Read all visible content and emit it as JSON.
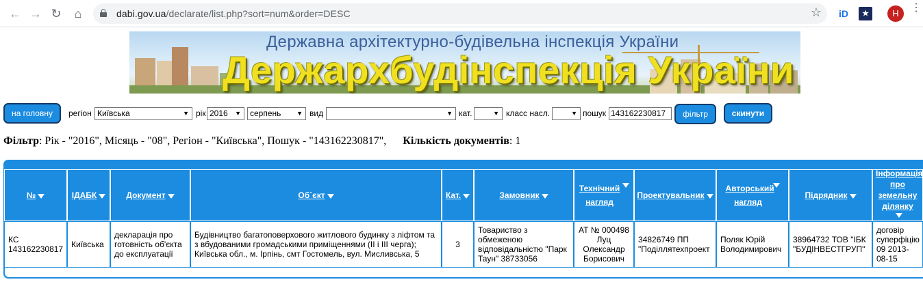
{
  "browser": {
    "url_host": "dabi.gov.ua",
    "url_path": "/declarate/list.php?sort=num&order=DESC",
    "profile_initial": "H",
    "ext1_label": "iD"
  },
  "banner": {
    "subtitle": "Державна архітектурно-будівельна інспекція України",
    "title": "Держархбудінспекція України"
  },
  "filters": {
    "home_button": "на головну",
    "region_label": "регіон",
    "region_value": "Київська",
    "year_label": "рік",
    "year_value": "2016",
    "month_value": "серпень",
    "type_label": "вид",
    "type_value": "",
    "category_label": "кат.",
    "category_value": "",
    "class_label": "класс насл.",
    "class_value": "",
    "search_label": "пошук",
    "search_value": "143162230817",
    "filter_button": "фільтр",
    "reset_button": "скинути"
  },
  "summary": {
    "filter_label": "Фільтр",
    "filter_text": ": Рік - \"2016\", Місяць - \"08\", Регіон - \"Київська\", Пошук - \"143162230817\",      ",
    "count_label": "Кількість документів",
    "count_text": ": 1"
  },
  "table": {
    "headers": [
      "№",
      "ІДАБК",
      "Документ",
      "Об`єкт",
      "Кат.",
      "Замовник",
      "Технічний нагляд",
      "Проектувальник",
      "Авторський нагляд",
      "Підрядник",
      "Інформація про земельну ділянку"
    ],
    "rows": [
      [
        "КС 143162230817",
        "Київська",
        "декларація про готовність об'єкта до експлуатації",
        "Будівництво багатоповерхового житлового будинку з ліфтом та з вбудованими громадськими приміщеннями (ІІ і ІІІ черга); Київська обл., м. Ірпінь, смт Гостомель, вул. Мисливська, 5",
        "3",
        "Товариство з обмеженою відповідальністю \"Парк Таун\" 38733056",
        "АТ № 000498 Луц Олександр Борисович",
        "34826749 ПП \"Поділлятехпроект",
        "Поляк Юрій Володимирович",
        "38964732 ТОВ \"ІБК \"БУДІНВЕСТГРУП\"",
        "договір суперфіцію 09 2013-08-15"
      ]
    ]
  },
  "colors": {
    "accent": "#1b8ce0",
    "button_border": "#123a66",
    "banner_title": "#f0e020"
  }
}
